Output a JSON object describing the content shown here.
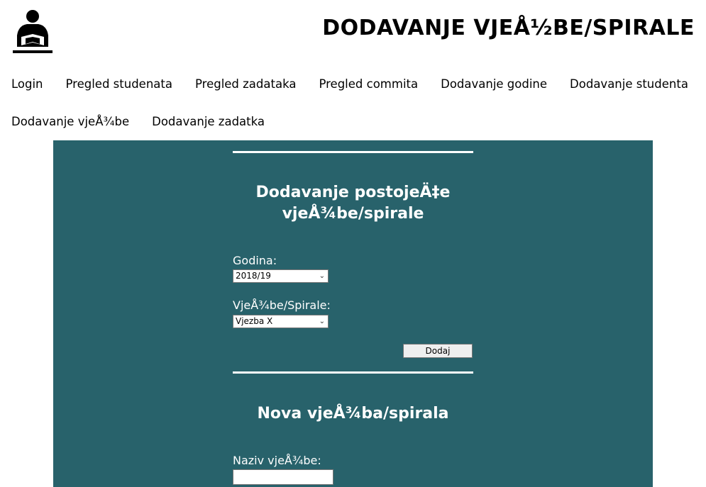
{
  "header": {
    "logo_icon": "reader-icon",
    "title": "DODAVANJE VJEÅ½BE/SPIRALE"
  },
  "nav": {
    "row1": [
      "Login",
      "Pregled studenata",
      "Pregled zadataka",
      "Pregled commita",
      "Dodavanje godine",
      "Dodavanje studenta"
    ],
    "row2": [
      "Dodavanje vjeÅ¾be",
      "Dodavanje zadatka"
    ]
  },
  "colors": {
    "panel": "#28626b",
    "text_on_panel": "#ffffff"
  },
  "existing_form": {
    "title_line1": "Dodavanje postojeÄ‡e",
    "title_line2": "vjeÅ¾be/spirale",
    "year_label": "Godina:",
    "year_value": "2018/19",
    "exercise_label": "VjeÅ¾be/Spirale:",
    "exercise_value": "Vjezba X",
    "submit_label": "Dodaj"
  },
  "new_form": {
    "title": "Nova vjeÅ¾ba/spirala",
    "name_label": "Naziv vjeÅ¾be:",
    "name_value": ""
  }
}
